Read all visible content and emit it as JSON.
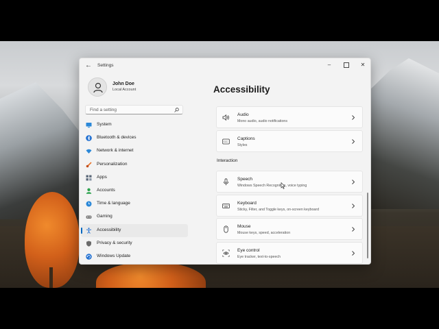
{
  "window": {
    "app_title": "Settings",
    "back_icon": "back-arrow-icon",
    "controls": [
      "minimize-icon",
      "maximize-icon",
      "close-icon"
    ]
  },
  "profile": {
    "name": "John Doe",
    "account_type": "Local Account"
  },
  "search": {
    "placeholder": "Find a setting"
  },
  "nav": {
    "items": [
      {
        "label": "System",
        "icon": "system-monitor-icon",
        "color": "#2b88d8"
      },
      {
        "label": "Bluetooth & devices",
        "icon": "bluetooth-icon",
        "color": "#1f6fd1"
      },
      {
        "label": "Network & internet",
        "icon": "wifi-icon",
        "color": "#2b88d8"
      },
      {
        "label": "Personalization",
        "icon": "paintbrush-icon",
        "color": "#e8742a"
      },
      {
        "label": "Apps",
        "icon": "apps-grid-icon",
        "color": "#5d6a7a"
      },
      {
        "label": "Accounts",
        "icon": "account-icon",
        "color": "#2ba24c"
      },
      {
        "label": "Time & language",
        "icon": "clock-globe-icon",
        "color": "#2b88d8"
      },
      {
        "label": "Gaming",
        "icon": "game-controller-icon",
        "color": "#7a7a7a"
      },
      {
        "label": "Accessibility",
        "icon": "accessibility-icon",
        "color": "#1f6fd1",
        "active": true
      },
      {
        "label": "Privacy & security",
        "icon": "shield-icon",
        "color": "#6b6b6b"
      },
      {
        "label": "Windows Update",
        "icon": "update-icon",
        "color": "#1f6fd1"
      }
    ]
  },
  "main": {
    "title": "Accessibility",
    "section_label": "Interaction",
    "cards_top": [
      {
        "title": "Audio",
        "subtitle": "Mono audio, audio notifications",
        "icon": "speaker-icon"
      },
      {
        "title": "Captions",
        "subtitle": "Styles",
        "icon": "captions-icon"
      }
    ],
    "cards_interaction": [
      {
        "title": "Speech",
        "subtitle": "Windows Speech Recognition, voice typing",
        "icon": "microphone-icon"
      },
      {
        "title": "Keyboard",
        "subtitle": "Sticky, Filter, and Toggle keys, on-screen keyboard",
        "icon": "keyboard-icon"
      },
      {
        "title": "Mouse",
        "subtitle": "Mouse keys, speed, acceleration",
        "icon": "mouse-icon"
      },
      {
        "title": "Eye control",
        "subtitle": "Eye tracker, text-to-speech",
        "icon": "eye-control-icon"
      }
    ]
  },
  "colors": {
    "accent": "#0067c0",
    "window_bg": "#f3f3f3",
    "card_bg": "#fbfbfb"
  }
}
